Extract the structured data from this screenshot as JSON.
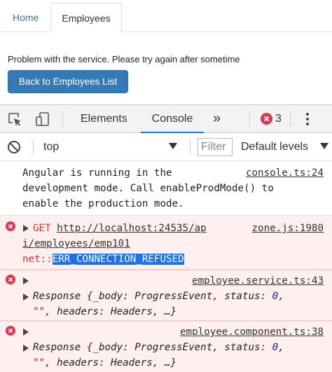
{
  "app": {
    "tabs": [
      {
        "label": "Home"
      },
      {
        "label": "Employees"
      }
    ],
    "error_message": "Problem with the service. Please try again after sometime",
    "back_button": "Back to Employees List"
  },
  "devtools": {
    "tabs": {
      "elements": "Elements",
      "console": "Console",
      "more": "»"
    },
    "error_count": "3",
    "context": "top",
    "filter_placeholder": "Filter",
    "levels": "Default levels",
    "colors": {
      "accent": "#1a73e8",
      "error_icon": "#e0364d",
      "error_text": "#e4322b",
      "error_bg": "#fff0f0",
      "link_blue": "#337ab7"
    },
    "console_messages": [
      {
        "type": "info",
        "lines": [
          "Angular is running in the",
          "development mode. Call enableProdMode() to",
          "enable the production mode."
        ],
        "source": "console.ts:24"
      },
      {
        "type": "error",
        "method": "GET",
        "url_line1": "http://localhost:24535/ap",
        "url_line2": "i/employees/emp101",
        "net_prefix": "net::",
        "net_error": "ERR_CONNECTION_REFUSED",
        "source": "zone.js:1980"
      },
      {
        "type": "error",
        "source": "employee.service.ts:43",
        "line1": "Response {_body: ProgressEvent, status: ",
        "status": "0",
        "line1_end": ",",
        "empty_str": "\"\"",
        "line2_rest": ", headers: Headers, …}"
      },
      {
        "type": "error",
        "source": "employee.component.ts:38",
        "line1": "Response {_body: ProgressEvent, status: ",
        "status": "0",
        "line1_end": ",",
        "empty_str": "\"\"",
        "line2_rest": ", headers: Headers, …}"
      }
    ]
  }
}
